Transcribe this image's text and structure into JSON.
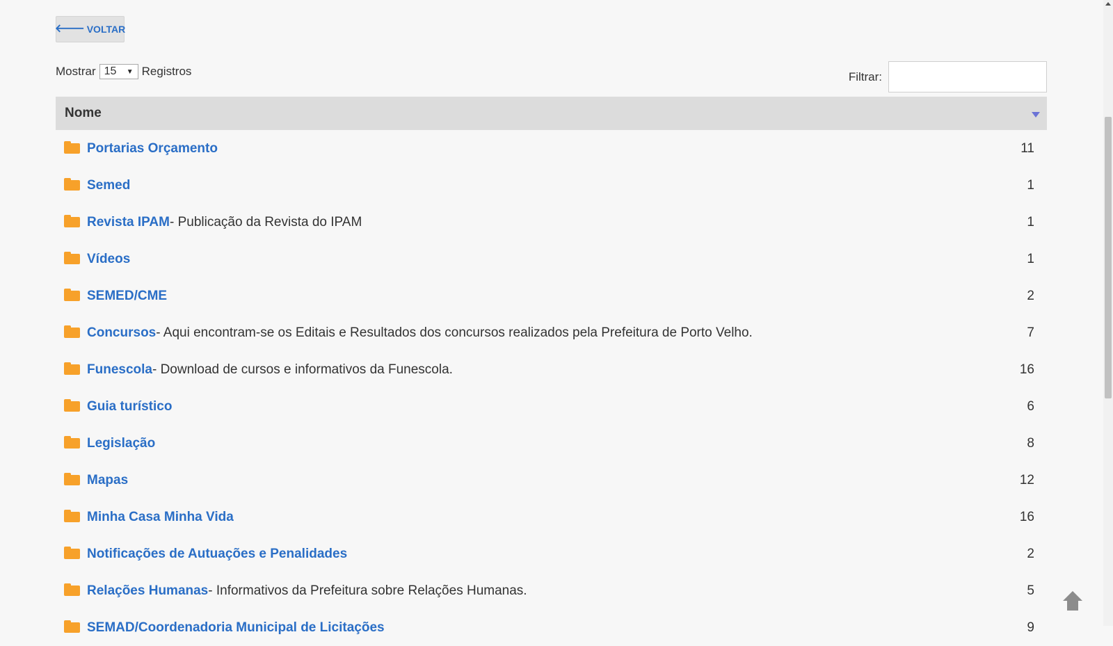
{
  "back_button": {
    "label": "VOLTAR",
    "icon": "arrow-left-icon"
  },
  "length_control": {
    "prefix": "Mostrar",
    "selected": "15",
    "suffix": "Registros"
  },
  "filter": {
    "label": "Filtrar:",
    "value": "",
    "placeholder": ""
  },
  "table": {
    "header": "Nome",
    "rows": [
      {
        "name": "Portarias Orçamento",
        "desc": "",
        "count": "11"
      },
      {
        "name": "Semed",
        "desc": "",
        "count": "1"
      },
      {
        "name": "Revista IPAM",
        "desc": " - Publicação da Revista do IPAM",
        "count": "1"
      },
      {
        "name": "Vídeos",
        "desc": "",
        "count": "1"
      },
      {
        "name": "SEMED/CME",
        "desc": "",
        "count": "2"
      },
      {
        "name": "Concursos",
        "desc": " - Aqui encontram-se os Editais e Resultados dos concursos realizados pela Prefeitura de Porto Velho.",
        "count": "7"
      },
      {
        "name": "Funescola",
        "desc": " - Download de cursos e informativos da Funescola.",
        "count": "16"
      },
      {
        "name": "Guia turístico",
        "desc": "",
        "count": "6"
      },
      {
        "name": "Legislação",
        "desc": "",
        "count": "8"
      },
      {
        "name": "Mapas",
        "desc": "",
        "count": "12"
      },
      {
        "name": "Minha Casa Minha Vida",
        "desc": "",
        "count": "16"
      },
      {
        "name": "Notificações de Autuações e Penalidades",
        "desc": "",
        "count": "2"
      },
      {
        "name": "Relações Humanas",
        "desc": " - Informativos da Prefeitura sobre Relações Humanas.",
        "count": "5"
      },
      {
        "name": "SEMAD/Coordenadoria Municipal de Licitações",
        "desc": "",
        "count": "9"
      }
    ]
  },
  "colors": {
    "link": "#2a6ec6",
    "folder": "#f7a12a",
    "header_bg": "#dcdcdc",
    "sort_arrow": "#6b73d6"
  }
}
